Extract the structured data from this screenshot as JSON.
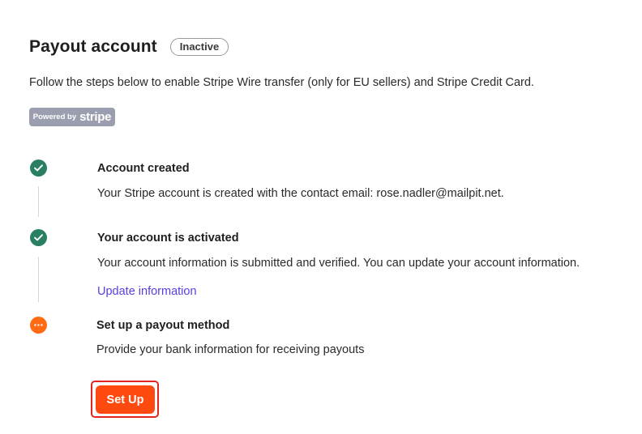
{
  "header": {
    "title": "Payout account",
    "status": "Inactive"
  },
  "subtitle": "Follow the steps below to enable Stripe Wire transfer (only for EU sellers) and Stripe Credit Card.",
  "stripe_badge": {
    "prefix": "Powered by",
    "brand": "stripe"
  },
  "steps": [
    {
      "status": "complete",
      "icon": "check-icon",
      "title": "Account created",
      "description": "Your Stripe account is created with the contact email: rose.nadler@mailpit.net."
    },
    {
      "status": "complete",
      "icon": "check-icon",
      "title": "Your account is activated",
      "description": "Your account information is submitted and verified. You can update your account information.",
      "link": "Update information"
    },
    {
      "status": "pending",
      "icon": "ellipsis-icon",
      "title": "Set up a payout method",
      "description": "Provide your bank information for receiving payouts",
      "button": "Set Up"
    }
  ],
  "colors": {
    "complete": "#2a7f62",
    "pending": "#ff6a13",
    "primary_button": "#ff4a0f",
    "link": "#5a3ee0",
    "highlight_border": "#e2261f"
  }
}
